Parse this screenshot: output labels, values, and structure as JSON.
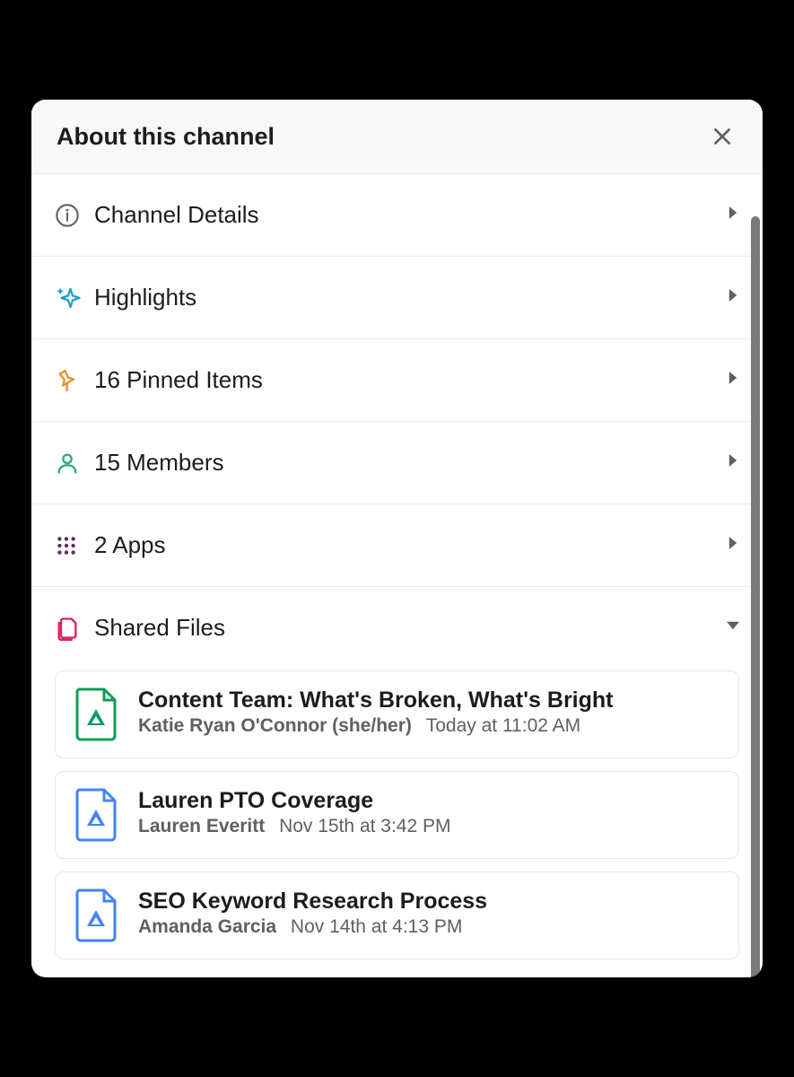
{
  "header": {
    "title": "About this channel"
  },
  "sections": {
    "details": {
      "label": "Channel Details"
    },
    "highlights": {
      "label": "Highlights"
    },
    "pinned": {
      "label": "16 Pinned Items"
    },
    "members": {
      "label": "15 Members"
    },
    "apps": {
      "label": "2 Apps"
    },
    "shared": {
      "label": "Shared Files"
    }
  },
  "files": [
    {
      "title": "Content Team: What's Broken, What's Bright",
      "author": "Katie Ryan O'Connor (she/her)",
      "time": "Today at 11:02 AM",
      "type": "sheet"
    },
    {
      "title": "Lauren PTO Coverage",
      "author": "Lauren Everitt",
      "time": "Nov 15th at 3:42 PM",
      "type": "doc"
    },
    {
      "title": "SEO Keyword Research Process",
      "author": "Amanda Garcia",
      "time": "Nov 14th at 4:13 PM",
      "type": "doc"
    }
  ],
  "colors": {
    "highlight_blue": "#1d9bd1",
    "pin_orange": "#e8912d",
    "member_green": "#2bac76",
    "apps_purple": "#4a154b",
    "files_red": "#e01e5a",
    "doc_blue": "#4285f4",
    "sheet_green": "#0f9d58"
  }
}
